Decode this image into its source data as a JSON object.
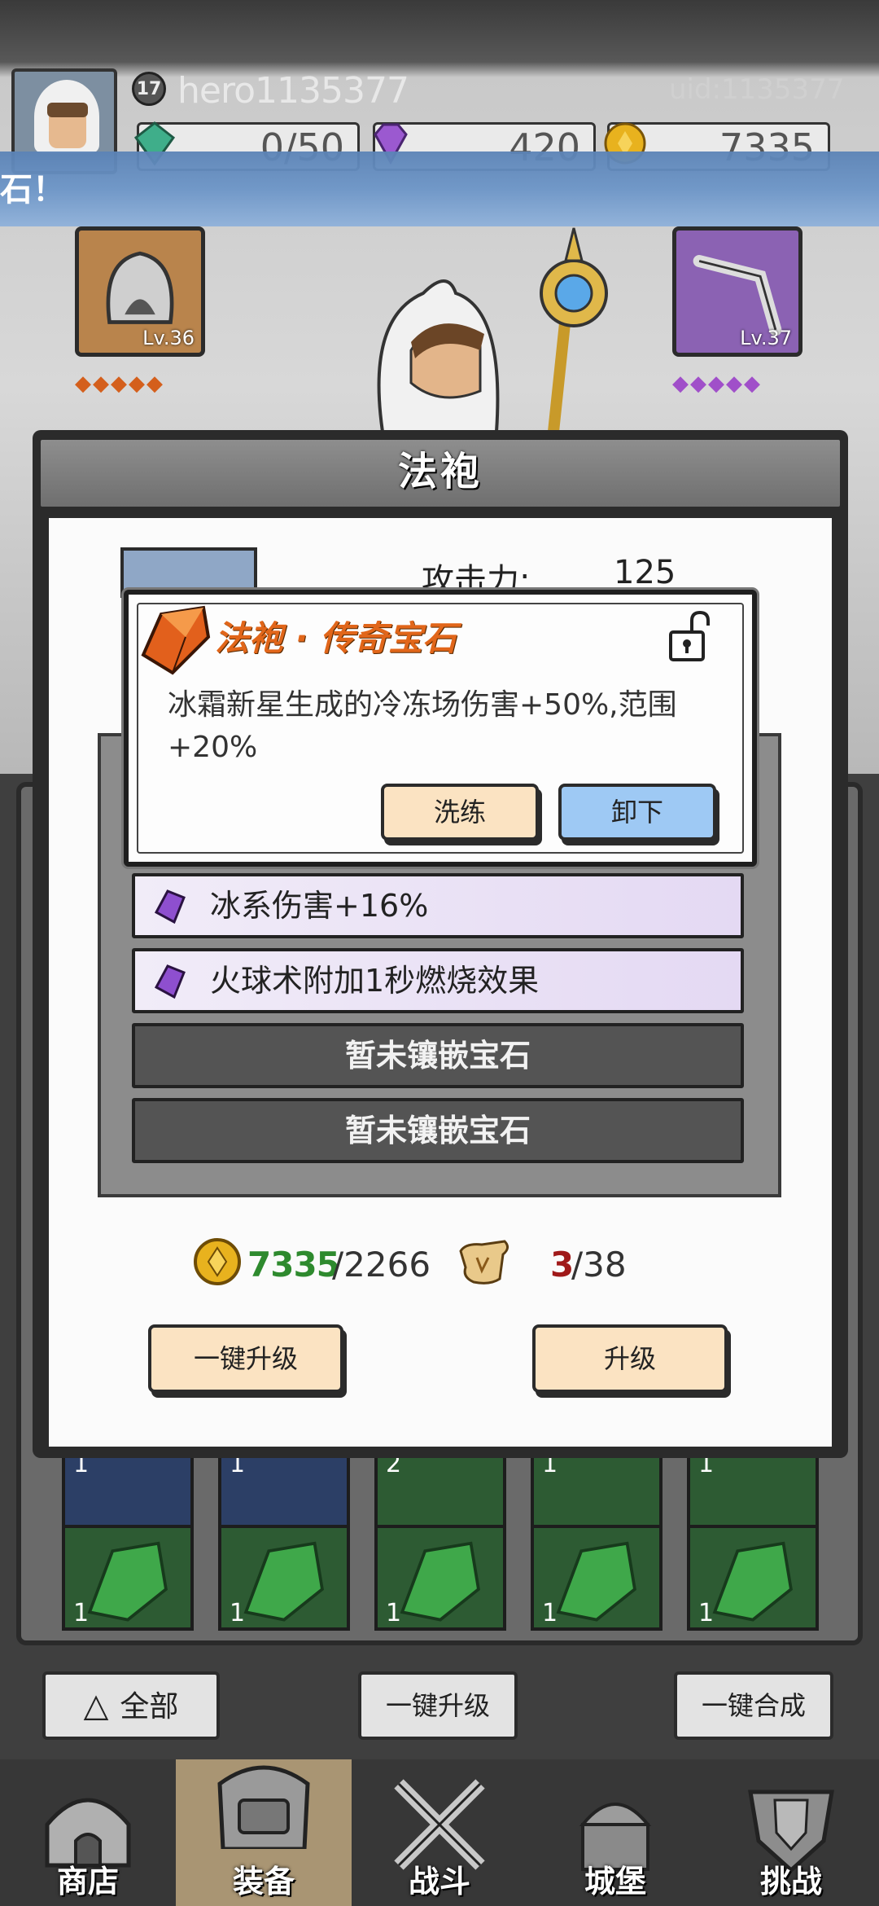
{
  "player": {
    "level": "17",
    "name": "hero1135377",
    "uid": "uid:1135377",
    "emerald": "0/50",
    "gems": "420",
    "gold": "7335"
  },
  "notice": {
    "text": "石！"
  },
  "equipment": {
    "left_slot_level": "Lv.36",
    "right_slot_level": "Lv.37",
    "left_diamonds": "◆◆◆◆◆",
    "right_diamonds": "◆◆◆◆◆"
  },
  "dialog": {
    "title": "法袍",
    "attack_label": "攻击力:",
    "attack_value": "125",
    "gem_slots": [
      {
        "label": "冰系伤害+16%",
        "state": "filled"
      },
      {
        "label": "火球术附加1秒燃烧效果",
        "state": "filled"
      },
      {
        "label": "暂未镶嵌宝石",
        "state": "empty"
      },
      {
        "label": "暂未镶嵌宝石",
        "state": "empty"
      }
    ],
    "cost": {
      "gold_have": "7335",
      "gold_need": "/2266",
      "scroll_have": "3",
      "scroll_need": "/38"
    },
    "upgrade_all_label": "一键升级",
    "upgrade_label": "升级"
  },
  "tooltip": {
    "title": "法袍 · 传奇宝石",
    "description": "冰霜新星生成的冷冻场伤害+50%,范围+20%",
    "reroll_label": "洗练",
    "unequip_label": "卸下"
  },
  "bag": {
    "top_counts": [
      "1",
      "1",
      "2",
      "1",
      "1"
    ],
    "bottom_counts": [
      "1",
      "1",
      "1",
      "1",
      "1"
    ]
  },
  "action_bar": {
    "filter_label": "全部",
    "upgrade_all_label": "一键升级",
    "merge_all_label": "一键合成"
  },
  "tabs": [
    {
      "label": "商店",
      "icon": "shop-hut-icon"
    },
    {
      "label": "装备",
      "icon": "backpack-icon"
    },
    {
      "label": "战斗",
      "icon": "crossed-swords-icon"
    },
    {
      "label": "城堡",
      "icon": "castle-icon"
    },
    {
      "label": "挑战",
      "icon": "shield-helmet-icon"
    }
  ],
  "colors": {
    "accent_orange": "#e1661a",
    "button_cream": "#fbe3c2",
    "button_blue": "#9ec9f4",
    "gold_green": "#2e8a2e",
    "scroll_red": "#a01919",
    "active_tab": "#a99573"
  }
}
